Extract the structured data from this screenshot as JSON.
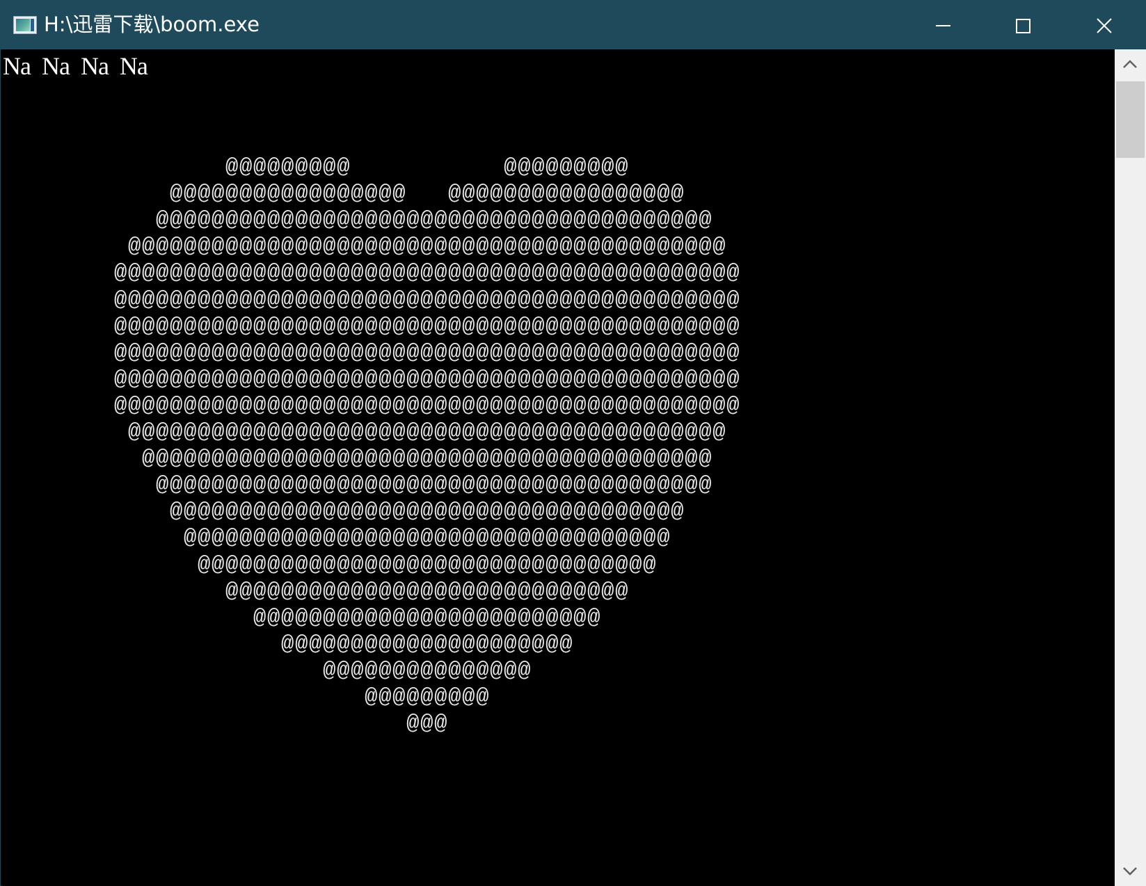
{
  "window": {
    "title": "H:\\迅雷下载\\boom.exe",
    "titlebar_color": "#1f4a5c",
    "background": "#000000",
    "text_color": "#ffffff"
  },
  "icons": {
    "app": "console-app-icon",
    "minimize": "minimize-icon",
    "maximize": "maximize-icon",
    "close": "close-icon",
    "scroll_up": "chevron-up-icon",
    "scroll_down": "chevron-down-icon"
  },
  "console": {
    "header": "Na Na Na Na",
    "heart_lines": [
      "                @@@@@@@@@           @@@@@@@@@",
      "            @@@@@@@@@@@@@@@@@   @@@@@@@@@@@@@@@@@",
      "           @@@@@@@@@@@@@@@@@@@@@@@@@@@@@@@@@@@@@@@@",
      "         @@@@@@@@@@@@@@@@@@@@@@@@@@@@@@@@@@@@@@@@@@@",
      "        @@@@@@@@@@@@@@@@@@@@@@@@@@@@@@@@@@@@@@@@@@@@@",
      "        @@@@@@@@@@@@@@@@@@@@@@@@@@@@@@@@@@@@@@@@@@@@@",
      "        @@@@@@@@@@@@@@@@@@@@@@@@@@@@@@@@@@@@@@@@@@@@@",
      "        @@@@@@@@@@@@@@@@@@@@@@@@@@@@@@@@@@@@@@@@@@@@@",
      "        @@@@@@@@@@@@@@@@@@@@@@@@@@@@@@@@@@@@@@@@@@@@@",
      "        @@@@@@@@@@@@@@@@@@@@@@@@@@@@@@@@@@@@@@@@@@@@@",
      "         @@@@@@@@@@@@@@@@@@@@@@@@@@@@@@@@@@@@@@@@@@@",
      "          @@@@@@@@@@@@@@@@@@@@@@@@@@@@@@@@@@@@@@@@@",
      "           @@@@@@@@@@@@@@@@@@@@@@@@@@@@@@@@@@@@@@@@",
      "            @@@@@@@@@@@@@@@@@@@@@@@@@@@@@@@@@@@@@",
      "             @@@@@@@@@@@@@@@@@@@@@@@@@@@@@@@@@@@",
      "              @@@@@@@@@@@@@@@@@@@@@@@@@@@@@@@@@",
      "                @@@@@@@@@@@@@@@@@@@@@@@@@@@@@",
      "                  @@@@@@@@@@@@@@@@@@@@@@@@@",
      "                    @@@@@@@@@@@@@@@@@@@@@",
      "                       @@@@@@@@@@@@@@@",
      "                          @@@@@@@@@",
      "                             @@@"
    ]
  }
}
